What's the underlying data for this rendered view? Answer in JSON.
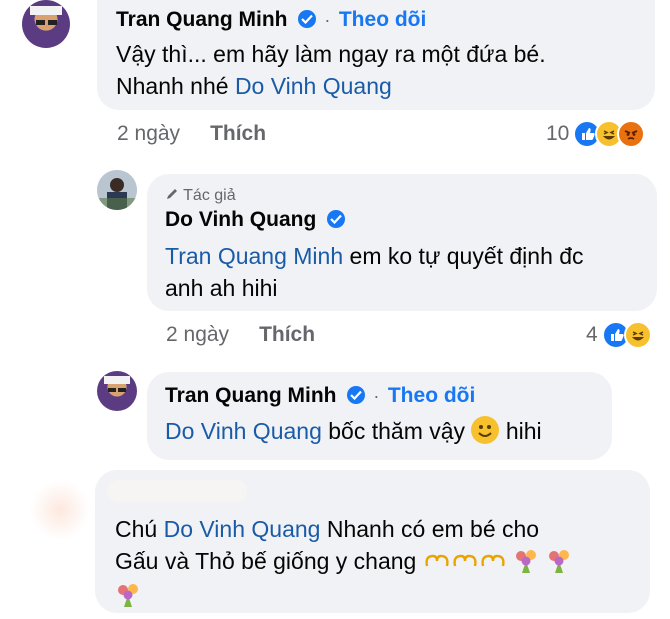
{
  "comments": [
    {
      "author": "Tran Quang Minh",
      "follow_label": "Theo dõi",
      "line1": "Vậy thì... em hãy làm ngay ra một đứa bé.",
      "line2_prefix": "Nhanh nhé ",
      "mention": "Do Vinh Quang",
      "time": "2 ngày",
      "like_label": "Thích",
      "reaction_count": "10"
    },
    {
      "author_badge": "Tác giả",
      "author": "Do Vinh Quang",
      "mention": "Tran Quang Minh",
      "line1_suffix": " em ko tự quyết định đc",
      "line2": "anh ah hihi",
      "time": "2 ngày",
      "like_label": "Thích",
      "reaction_count": "4"
    },
    {
      "author": "Tran Quang Minh",
      "follow_label": "Theo dõi",
      "mention": "Do Vinh Quang",
      "text_suffix": " bốc thăm vậy ",
      "text_end": " hihi"
    },
    {
      "line1_prefix": "Chú ",
      "mention": "Do Vinh Quang",
      "line1_suffix": " Nhanh có em bé cho",
      "line2": "Gấu và Thỏ bế giống y chang "
    }
  ],
  "colors": {
    "bubble": "#f0f2f5",
    "link": "#1877f2",
    "mention": "#1a5ba8",
    "meta": "#65676b"
  }
}
